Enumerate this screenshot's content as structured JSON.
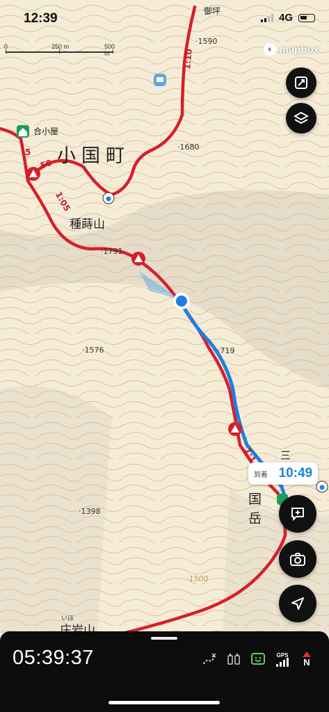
{
  "status_bar": {
    "time": "12:39",
    "network": "4G"
  },
  "map": {
    "scale_labels": [
      "0",
      "250 m",
      "500 m"
    ],
    "attribution": "mapbox",
    "labels": {
      "town": "小国町",
      "mountain_tanemaki": "種蒔山",
      "hut": "合小屋",
      "peak_oguni_1": "三",
      "peak_oguni_2": "国",
      "peak_oguni_3": "岳",
      "mikoshibu": "御坪",
      "bottom_mountain": "庄岩山",
      "bottom_small": "いほ"
    },
    "elevations": [
      "1590",
      "1680",
      "1791",
      "1576",
      "719",
      "1398",
      "1500"
    ],
    "trail_times": [
      "1:10",
      "50",
      "1:05",
      "1:1",
      "5"
    ],
    "colors": {
      "trail": "#d61f2c",
      "route": "#1f7fe0",
      "contour": "#c9a25a"
    }
  },
  "eta": {
    "label": "到着",
    "value": "10:49"
  },
  "buttons": {
    "expand": "expand-icon",
    "layers": "layers-icon",
    "memo": "plus-note-icon",
    "camera": "camera-icon",
    "locate": "location-arrow-icon"
  },
  "bottom_panel": {
    "elapsed": "05:39:37",
    "indicators": [
      "route-off-icon",
      "battery-icon",
      "smile-icon",
      "GPS",
      "N"
    ]
  }
}
